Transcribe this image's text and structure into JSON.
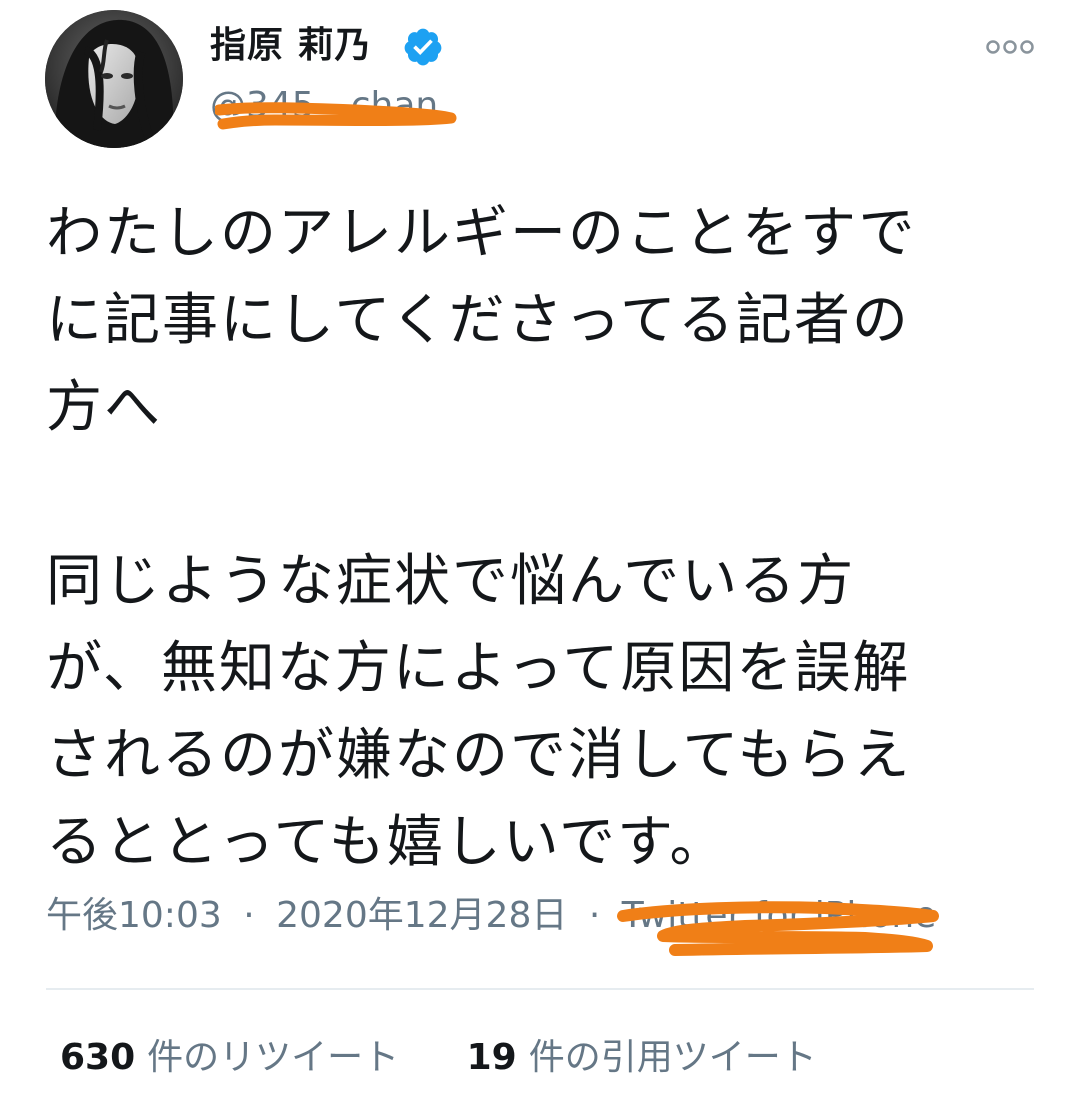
{
  "user": {
    "display_name": "指原 莉乃",
    "handle": "@345__chan",
    "verified": true,
    "avatar": "avatar-photo"
  },
  "tweet": {
    "lines": [
      "わたしのアレルギーのことをすで",
      "に記事にしてくださってる記者の",
      "方へ",
      "",
      "同じような症状で悩んでいる方",
      "が、無知な方によって原因を誤解",
      "されるのが嫌なので消してもらえ",
      "るととっても嬉しいです。"
    ]
  },
  "meta": {
    "time": "午後10:03",
    "separator": "·",
    "date": "2020年12月28日",
    "source": "Twitter for iPhone"
  },
  "stats": {
    "retweets": {
      "count": "630",
      "label": "件のリツイート"
    },
    "quotes": {
      "count": "19",
      "label": "件の引用ツイート"
    }
  },
  "colors": {
    "text": "#14171a",
    "muted": "#657786",
    "verified": "#1da1f2",
    "divider": "#e6ecf0",
    "scribble": "#f07f17"
  },
  "icons": {
    "verified": "verified-badge-icon",
    "more": "more-options-icon"
  }
}
